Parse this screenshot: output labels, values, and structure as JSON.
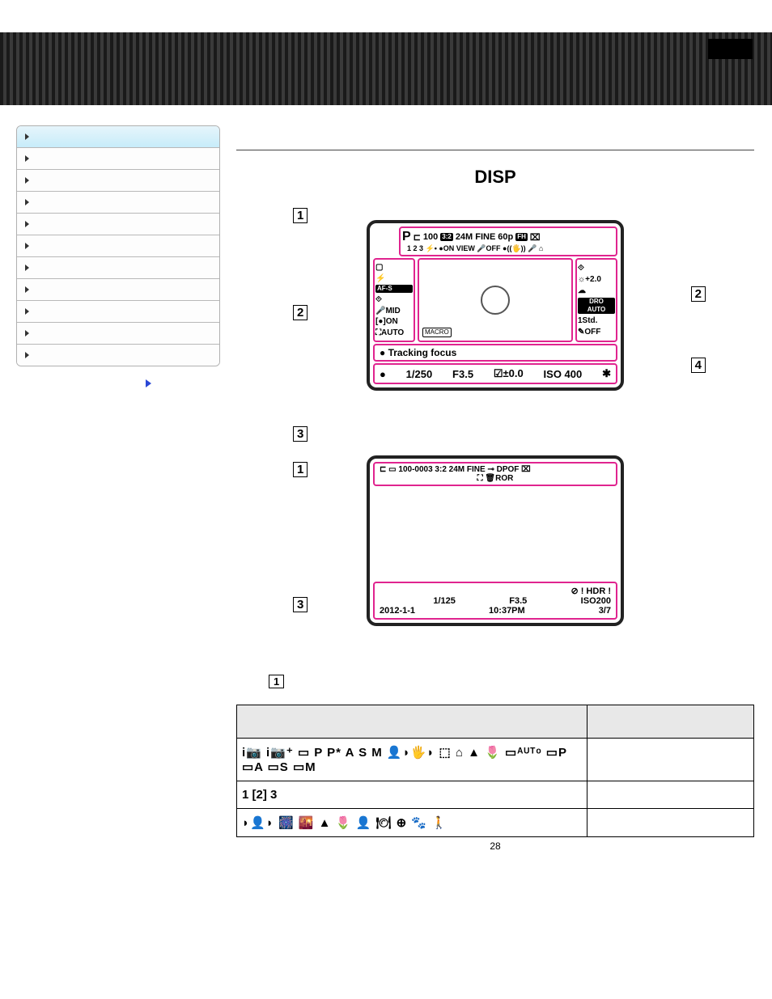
{
  "header": {},
  "sidebar": {
    "items": [
      {
        "label": ""
      },
      {
        "label": ""
      },
      {
        "label": ""
      },
      {
        "label": ""
      },
      {
        "label": ""
      },
      {
        "label": ""
      },
      {
        "label": ""
      },
      {
        "label": ""
      },
      {
        "label": ""
      },
      {
        "label": ""
      },
      {
        "label": ""
      }
    ],
    "sublink": ""
  },
  "disp_label": "DISP",
  "shooting_diagram": {
    "callouts": {
      "c1": "1",
      "c2": "2",
      "c3": "3",
      "c4": "4"
    },
    "top_line1": {
      "mode": "P",
      "battery": "⊏",
      "count": "100",
      "ratio": "3:2",
      "size": "24M",
      "quality": "FINE",
      "fps": "60p",
      "fh": "FH",
      "card": "⌧"
    },
    "top_line2": "1 2 3  ⚡• ●ON VIEW  🎤OFF ●((🖐)) 🎤 ⌂",
    "left_icons": [
      "▢",
      "⚡",
      "AF-S",
      "⟐",
      "🎤MID",
      "[●]ON",
      "⛶AUTO"
    ],
    "right_icons": [
      "⟐",
      "☼+2.0",
      "☁",
      "DRO AUTO",
      "1Std.",
      "✎OFF"
    ],
    "center_badge": "MACRO",
    "track_row": "●  Tracking focus",
    "bottom": {
      "dot": "●",
      "shutter": "1/250",
      "aperture": "F3.5",
      "ev": "☑±0.0",
      "iso": "ISO 400",
      "star": "✱"
    }
  },
  "playback_diagram": {
    "callouts": {
      "c1": "1",
      "c3": "3"
    },
    "top_l1": "⊏ ▭ 100-0003   3:2 24M  FINE  ⊸ DPOF  ⌧",
    "top_l2": "                      ⛶   🗑ROR",
    "icons_row": "⊘ ! HDR !",
    "bot_l1": {
      "a": "1/125",
      "b": "F3.5",
      "c": "ISO200"
    },
    "bot_l2": {
      "date": "2012-1-1",
      "time": "10:37PM",
      "count": "3/7"
    }
  },
  "section_callout": "1",
  "table": {
    "header": {
      "col1": "",
      "col2": ""
    },
    "rows": [
      {
        "icons": "i📷 i📷⁺ ▭ P P* A S M 👤◗🖐◗ ⬚ ⌂ ▲ 🌷 ▭ᴬᵁᵀᵒ  ▭P ▭A ▭S ▭M",
        "meaning": ""
      },
      {
        "icons": "1 [2] 3",
        "meaning": ""
      },
      {
        "icons": "◗👤◗ 🎆 🌇 ▲ 🌷 👤 🍽 ⊕ 🐾 🚶",
        "meaning": ""
      }
    ]
  },
  "page_number": "28"
}
